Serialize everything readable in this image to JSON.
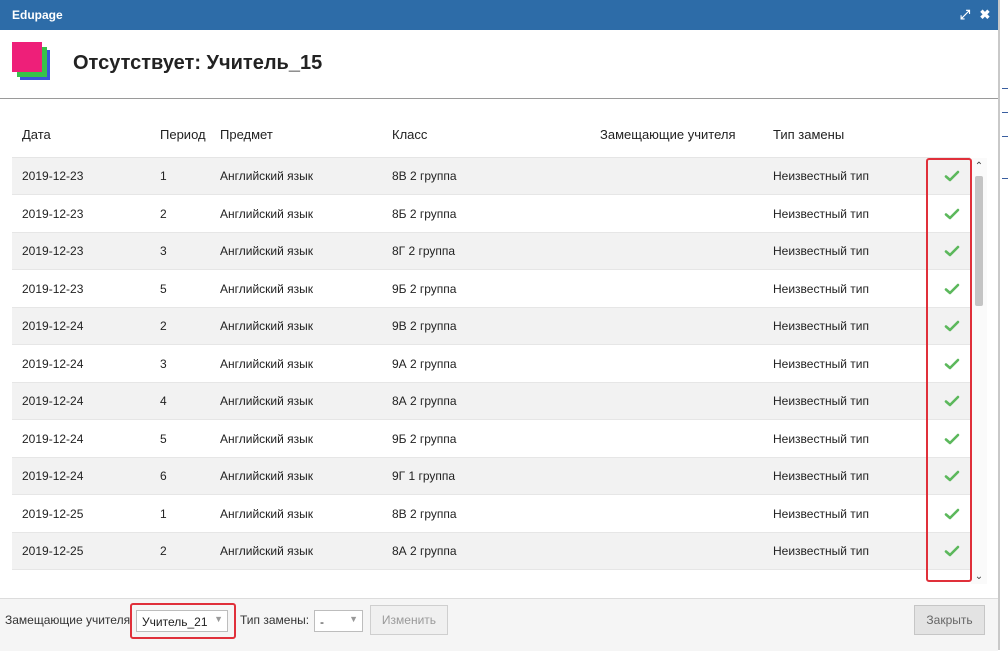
{
  "window": {
    "title": "Edupage",
    "maximize_icon": "expand-icon",
    "close_icon": "close-icon"
  },
  "header": {
    "title": "Отсутствует: Учитель_15"
  },
  "table": {
    "columns": [
      "Дата",
      "Период",
      "Предмет",
      "Класс",
      "Замещающие учителя",
      "Тип замены"
    ],
    "rows": [
      {
        "date": "2019-12-23",
        "period": "1",
        "subject": "Английский язык",
        "class": "8В 2 группа",
        "substitute": "",
        "type": "Неизвестный тип",
        "checked": true
      },
      {
        "date": "2019-12-23",
        "period": "2",
        "subject": "Английский язык",
        "class": "8Б 2 группа",
        "substitute": "",
        "type": "Неизвестный тип",
        "checked": true
      },
      {
        "date": "2019-12-23",
        "period": "3",
        "subject": "Английский язык",
        "class": "8Г 2 группа",
        "substitute": "",
        "type": "Неизвестный тип",
        "checked": true
      },
      {
        "date": "2019-12-23",
        "period": "5",
        "subject": "Английский язык",
        "class": "9Б 2 группа",
        "substitute": "",
        "type": "Неизвестный тип",
        "checked": true
      },
      {
        "date": "2019-12-24",
        "period": "2",
        "subject": "Английский язык",
        "class": "9В 2 группа",
        "substitute": "",
        "type": "Неизвестный тип",
        "checked": true
      },
      {
        "date": "2019-12-24",
        "period": "3",
        "subject": "Английский язык",
        "class": "9А 2 группа",
        "substitute": "",
        "type": "Неизвестный тип",
        "checked": true
      },
      {
        "date": "2019-12-24",
        "period": "4",
        "subject": "Английский язык",
        "class": "8А 2 группа",
        "substitute": "",
        "type": "Неизвестный тип",
        "checked": true
      },
      {
        "date": "2019-12-24",
        "period": "5",
        "subject": "Английский язык",
        "class": "9Б 2 группа",
        "substitute": "",
        "type": "Неизвестный тип",
        "checked": true
      },
      {
        "date": "2019-12-24",
        "period": "6",
        "subject": "Английский язык",
        "class": "9Г 1 группа",
        "substitute": "",
        "type": "Неизвестный тип",
        "checked": true
      },
      {
        "date": "2019-12-25",
        "period": "1",
        "subject": "Английский язык",
        "class": "8В 2 группа",
        "substitute": "",
        "type": "Неизвестный тип",
        "checked": true
      },
      {
        "date": "2019-12-25",
        "period": "2",
        "subject": "Английский язык",
        "class": "8А 2 группа",
        "substitute": "",
        "type": "Неизвестный тип",
        "checked": true
      }
    ]
  },
  "footer": {
    "substitute_label": "Замещающие учителя",
    "substitute_value": "Учитель_21",
    "type_label": "Тип замены:",
    "type_value": "-",
    "change_button": "Изменить",
    "close_button": "Закрыть"
  },
  "colors": {
    "titlebar": "#2d6ca8",
    "highlight": "#e0303a",
    "check": "#5cb85c"
  }
}
